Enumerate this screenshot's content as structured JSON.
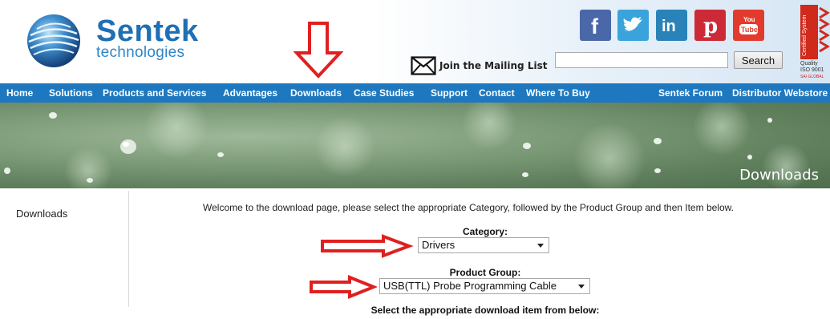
{
  "brand": {
    "name": "Sentek",
    "sub": "technologies"
  },
  "header": {
    "mailing_label": "Join the Mailing List",
    "search_placeholder": "",
    "search_button": "Search",
    "social": [
      {
        "name": "facebook",
        "glyph": "f"
      },
      {
        "name": "twitter",
        "glyph": "t"
      },
      {
        "name": "linkedin",
        "glyph": "in"
      },
      {
        "name": "pinterest",
        "glyph": "p"
      },
      {
        "name": "youtube",
        "glyph": "You Tube"
      }
    ],
    "iso": {
      "strip": "Certified System",
      "line1": "Quality",
      "line2": "ISO 9001",
      "line3": "SAI GLOBAL"
    }
  },
  "nav": {
    "items": [
      "Home",
      "Solutions",
      "Products and Services",
      "Advantages",
      "Downloads",
      "Case Studies",
      "Support",
      "Contact",
      "Where To Buy"
    ],
    "right_items": [
      "Sentek Forum",
      "Distributor Webstore"
    ]
  },
  "banner": {
    "title": "Downloads"
  },
  "sidebar": {
    "item": "Downloads"
  },
  "main": {
    "welcome": "Welcome to the download page, please select the appropriate Category, followed by the Product Group and then Item below.",
    "category_label": "Category:",
    "category_value": "Drivers",
    "product_group_label": "Product Group:",
    "product_group_value": "USB(TTL) Probe Programming Cable",
    "select_item_label": "Select the appropriate download item from below:"
  },
  "colors": {
    "nav_bg": "#1e78bf",
    "brand_blue": "#1f6fb5",
    "annotation_red": "#e02020"
  }
}
